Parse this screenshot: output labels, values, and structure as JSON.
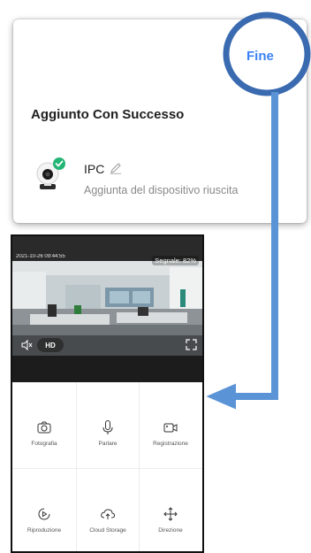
{
  "dialog": {
    "done_label": "Fine",
    "title": "Aggiunto Con Successo",
    "device_name": "IPC",
    "device_status": "Aggiunta del dispositivo riuscita"
  },
  "camera": {
    "timestamp": "2021-10-26 09:44:55",
    "signal": "Segnale: 82%",
    "quality": "HD"
  },
  "actions": [
    {
      "label": "Fotografia",
      "icon": "camera-icon"
    },
    {
      "label": "Parlare",
      "icon": "microphone-icon"
    },
    {
      "label": "Registrazione",
      "icon": "video-camera-icon"
    },
    {
      "label": "Riproduzione",
      "icon": "play-circle-icon"
    },
    {
      "label": "Cloud Storage",
      "icon": "cloud-storage-icon"
    },
    {
      "label": "Direzione",
      "icon": "direction-arrows-icon"
    }
  ],
  "colors": {
    "accent": "#3b82f6",
    "annotation": "#3a6ab0",
    "arrow": "#5b94d6",
    "success": "#22b573"
  }
}
